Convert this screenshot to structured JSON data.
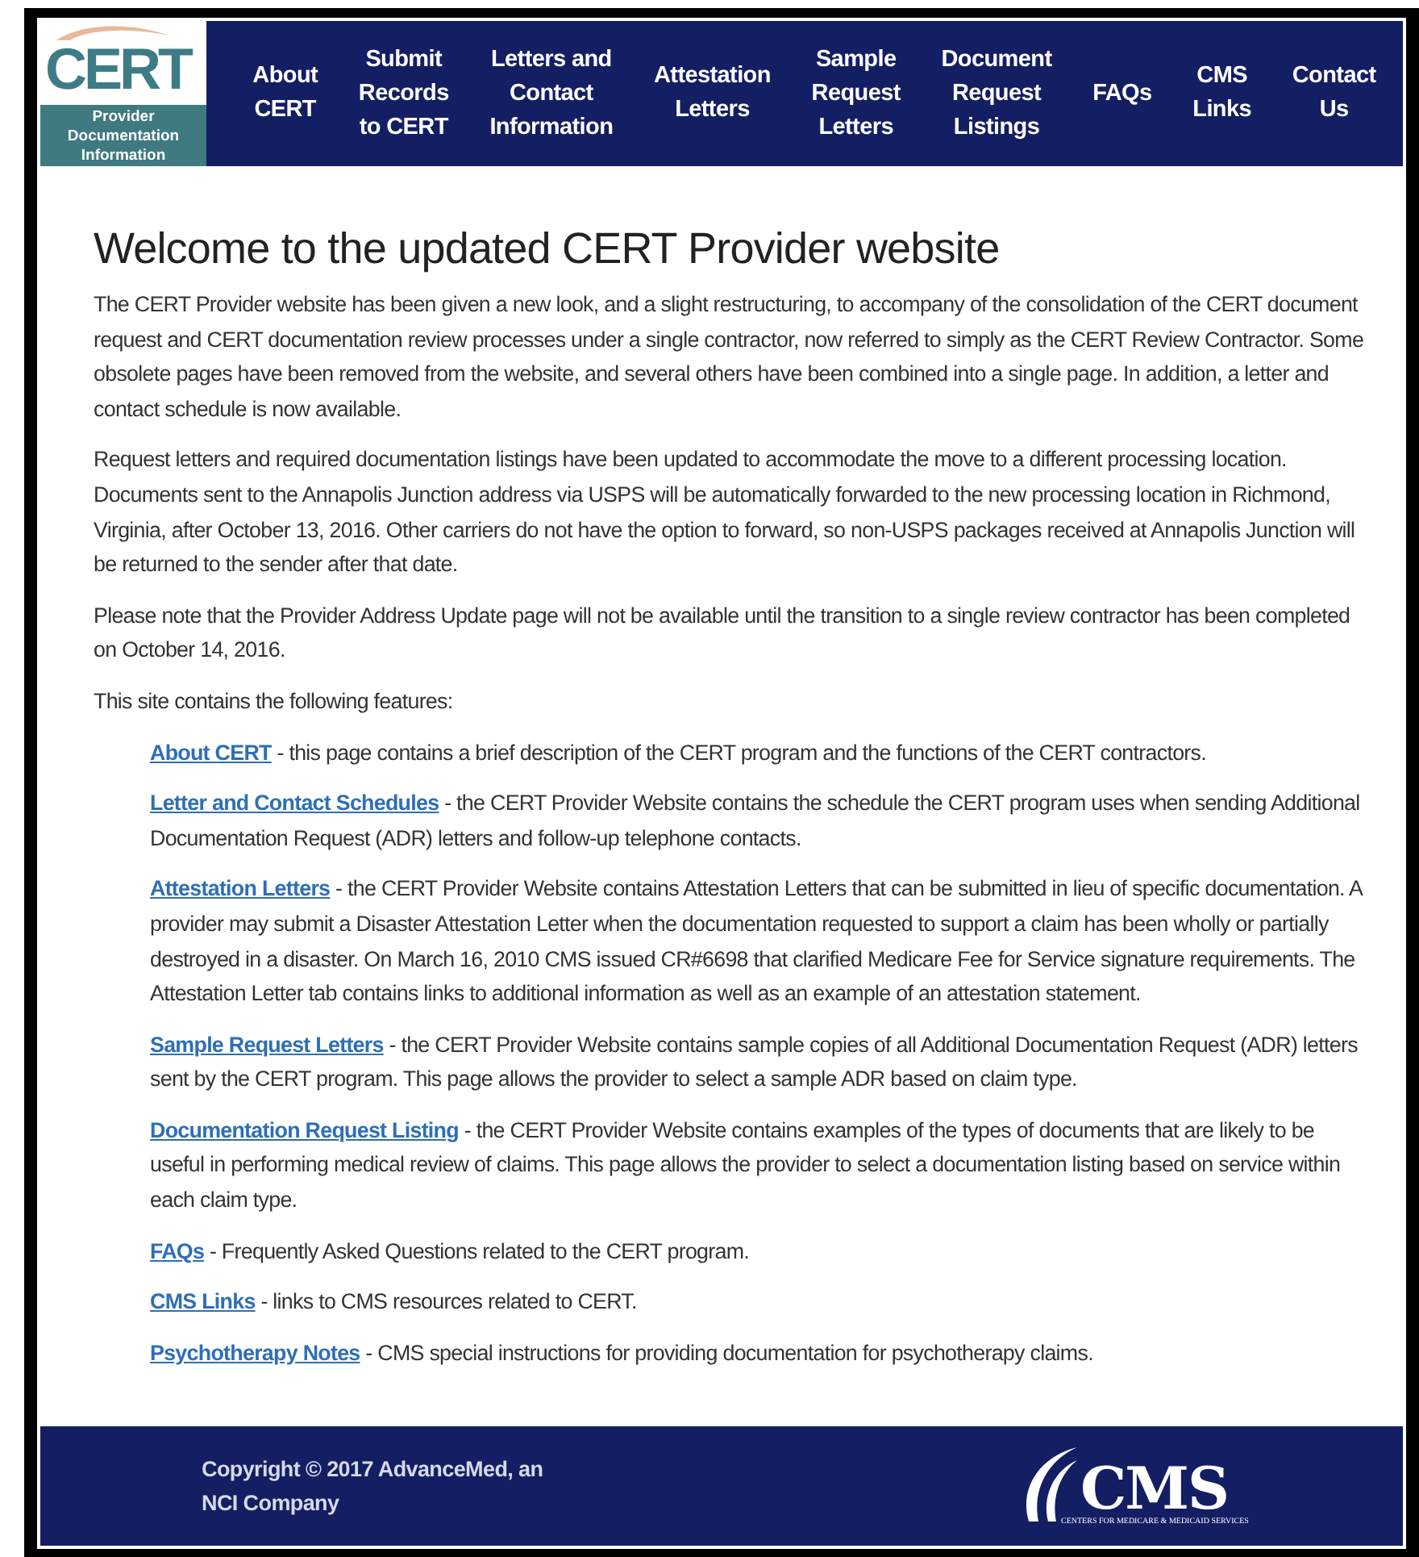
{
  "logo": {
    "wordmark": "CERT",
    "caption_lines": [
      "Provider",
      "Documentation",
      "Information"
    ]
  },
  "nav": [
    {
      "lines": [
        "About",
        "CERT"
      ]
    },
    {
      "lines": [
        "Submit",
        "Records",
        "to CERT"
      ]
    },
    {
      "lines": [
        "Letters and",
        "Contact",
        "Information"
      ]
    },
    {
      "lines": [
        "Attestation",
        "Letters"
      ]
    },
    {
      "lines": [
        "Sample",
        "Request",
        "Letters"
      ]
    },
    {
      "lines": [
        "Document",
        "Request",
        "Listings"
      ]
    },
    {
      "lines": [
        "FAQs"
      ]
    },
    {
      "lines": [
        "CMS",
        "Links"
      ]
    },
    {
      "lines": [
        "Contact",
        "Us"
      ]
    }
  ],
  "heading": "Welcome to the updated CERT Provider website",
  "paragraphs": [
    "The CERT Provider website has been given a new look, and a slight restructuring, to accompany of the consolidation of the CERT document request and CERT documentation review processes under a single contractor, now referred to simply as the CERT Review Contractor. Some obsolete pages have been removed from the website, and several others have been combined into a single page. In addition, a letter and contact schedule is now available.",
    "Request letters and required documentation listings have been updated to accommodate the move to a different processing location. Documents sent to the Annapolis Junction address via USPS will be automatically forwarded to the new processing location in Richmond, Virginia, after October 13, 2016. Other carriers do not have the option to forward, so non-USPS packages received at Annapolis Junction will be returned to the sender after that date.",
    "Please note that the Provider Address Update page will not be available until the transition to a single review contractor has been completed on October 14, 2016.",
    "This site contains the following features:"
  ],
  "features": [
    {
      "link": "About CERT",
      "description": "- this page contains a brief description of the CERT program and the functions of the CERT contractors."
    },
    {
      "link": "Letter and Contact Schedules",
      "description": "- the CERT Provider Website contains the schedule the CERT program uses when sending Additional Documentation Request (ADR) letters and follow-up telephone contacts."
    },
    {
      "link": "Attestation Letters",
      "description": "- the CERT Provider Website contains Attestation Letters that can be submitted in lieu of specific documentation. A provider may submit a Disaster Attestation Letter when the documentation requested to support a claim has been wholly or partially destroyed in a disaster. On March 16, 2010 CMS issued CR#6698 that clarified Medicare Fee for Service signature requirements. The Attestation Letter tab contains links to additional information as well as an example of an attestation statement."
    },
    {
      "link": "Sample Request Letters",
      "description": "- the CERT Provider Website contains sample copies of all Additional Documentation Request (ADR) letters sent by the CERT program. This page allows the provider to select a sample ADR based on claim type."
    },
    {
      "link": "Documentation Request Listing",
      "description": "- the CERT Provider Website contains examples of the types of documents that are likely to be useful in performing medical review of claims. This page allows the provider to select a documentation listing based on service within each claim type."
    },
    {
      "link": "FAQs",
      "description": "- Frequently Asked Questions related to the CERT program."
    },
    {
      "link": "CMS Links",
      "description": "- links to CMS resources related to CERT."
    },
    {
      "link": "Psychotherapy Notes",
      "description": "- CMS special instructions for providing documentation for psychotherapy claims."
    }
  ],
  "footer": {
    "copyright_lines": [
      "Copyright © 2017 AdvanceMed, an",
      "NCI Company"
    ],
    "cms_logo": {
      "wordmark": "CMS",
      "tagline": "CENTERS FOR MEDICARE & MEDICAID SERVICES"
    }
  }
}
